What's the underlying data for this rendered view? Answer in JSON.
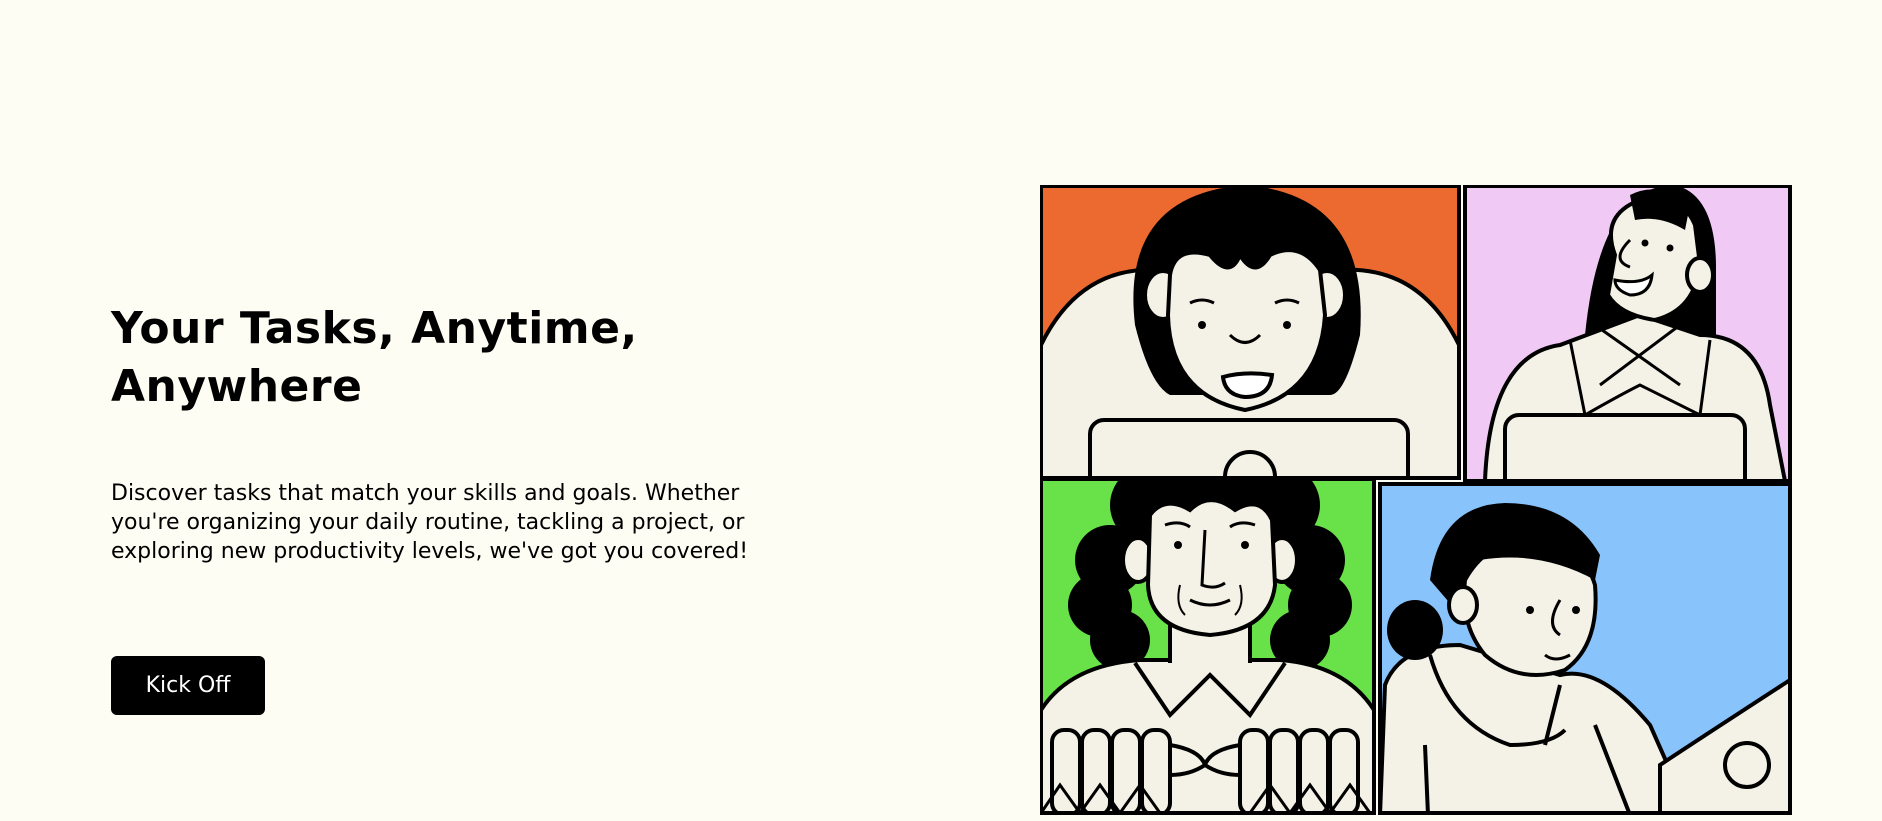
{
  "hero": {
    "title": "Your Tasks, Anytime, Anywhere",
    "description": "Discover tasks that match your skills and goals. Whether you're organizing your daily routine, tackling a project, or exploring new productivity levels, we've got you covered!",
    "cta_label": "Kick Off"
  },
  "colors": {
    "background": "#fefdf4",
    "button": "#000000",
    "button_text": "#ffffff",
    "panel_orange": "#ec6a2f",
    "panel_pink": "#f1c9f5",
    "panel_green": "#69e24a",
    "panel_blue": "#89c3fb",
    "skin": "#f4f2e6"
  },
  "illustration": {
    "name": "video-call-illustration",
    "panels": [
      "orange",
      "pink",
      "green",
      "blue"
    ]
  }
}
